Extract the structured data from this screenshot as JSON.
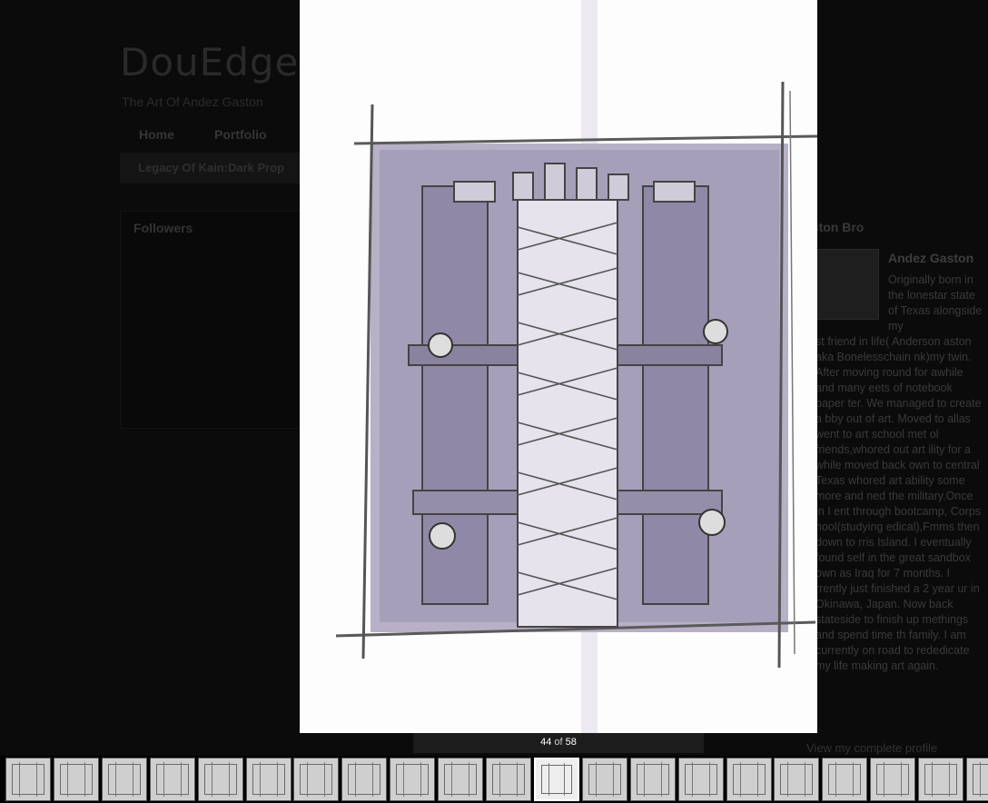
{
  "blog": {
    "title": "DouEdgeZ",
    "description": "The Art Of Andez Gaston",
    "tabs": [
      "Home",
      "Portfolio"
    ],
    "subnav": "Legacy Of Kain:Dark Prop",
    "followers_title": "Followers"
  },
  "profile": {
    "section_title": "aston Bro",
    "name": "Andez Gaston",
    "bio_lead": "Originally born in the lonestar state of Texas alongside my",
    "bio": "st friend in life( Anderson aston aka Bonelesschain nk)my twin. After moving round for awhile and many eets of notebook paper ter. We managed to create a bby out of art. Moved to allas went to art school met ol friends,whored out art ility for a while moved back own to central Texas whored art ability some more and ned the military.Once in I ent through bootcamp, Corps hool(studying edical),Fmms then down to rris Island. I eventually found self in the great sandbox own as Iraq for 7 months. I rrently just finished a 2 year ur in Okinawa, Japan. Now back stateside to finish up methings and spend time th family. I am currently on road to rededicate my life making art again.",
    "link": "View my complete profile"
  },
  "lightbox": {
    "current": "44",
    "of_label": "of",
    "total": "58",
    "image_icon": "pencil-sketch-artwork"
  },
  "thumbnails": {
    "count": 21,
    "active_index": 11
  },
  "colors": {
    "backdrop": "#000000",
    "sketch_wash": "#a9a2bf",
    "pencil": "#555555"
  }
}
